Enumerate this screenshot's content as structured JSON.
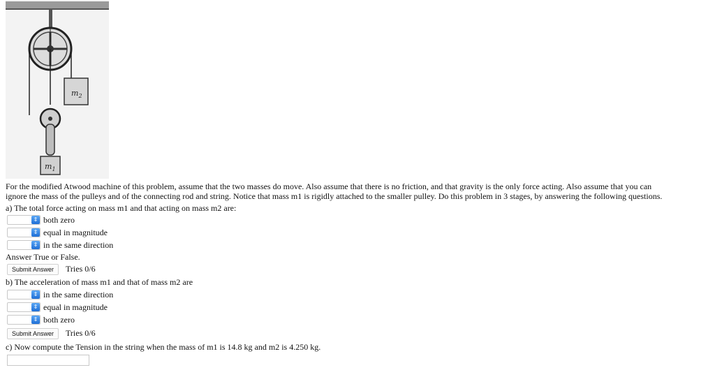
{
  "figure": {
    "label_m2": "m2",
    "label_m1": "m1"
  },
  "intro_line1": "For the modified Atwood machine of this problem, assume that the two masses do move. Also assume that there is no friction, and that gravity is the only force acting. Also assume that you can",
  "intro_line2": "ignore the mass of the pulleys and of the connecting rod and string. Notice that mass m1 is rigidly attached to the smaller pulley. Do this problem in 3 stages, by answering the following questions.",
  "part_a": {
    "question": "a) The total force acting on mass m1 and that acting on mass m2 are:",
    "options": [
      "both zero",
      "equal in magnitude",
      "in the same direction"
    ],
    "selected_values": [
      "",
      "",
      ""
    ],
    "instruction": "Answer True or False.",
    "submit_label": "Submit Answer",
    "tries": "Tries 0/6"
  },
  "part_b": {
    "question": "b) The acceleration of mass m1 and that of mass m2 are",
    "options": [
      "in the same direction",
      "equal in magnitude",
      "both zero"
    ],
    "selected_values": [
      "",
      "",
      ""
    ],
    "submit_label": "Submit Answer",
    "tries": "Tries 0/6"
  },
  "part_c": {
    "question": "c) Now compute the Tension in the string when the mass of m1 is 14.8 kg and m2 is 4.250 kg.",
    "answer_value": ""
  },
  "icons": {
    "select_arrow": "select-arrow-icon"
  }
}
